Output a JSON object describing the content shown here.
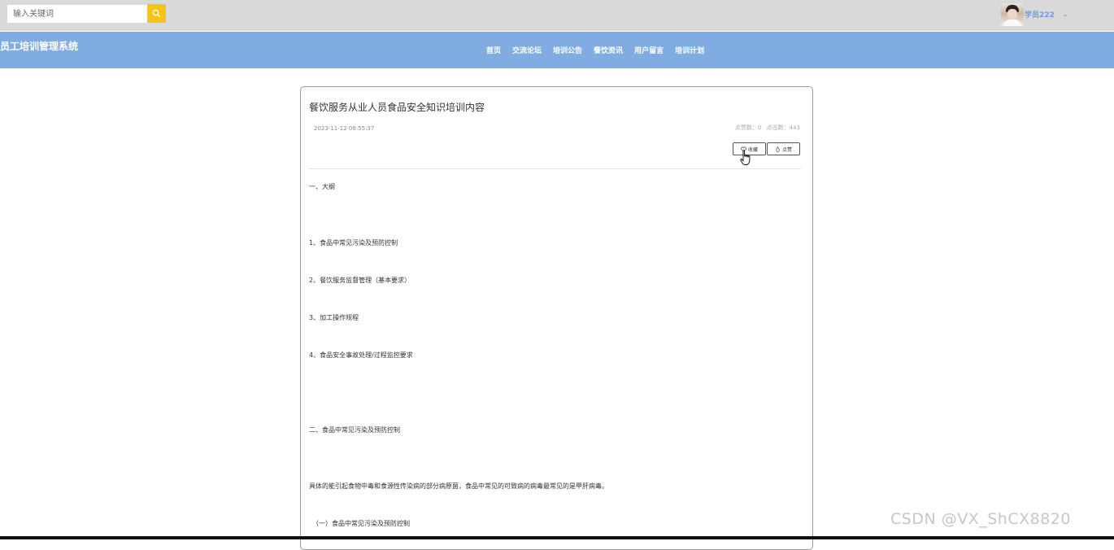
{
  "search": {
    "placeholder": "输入关键词"
  },
  "user": {
    "name": "学员222"
  },
  "brand": {
    "title": "员工培训管理系统"
  },
  "nav": [
    "首页",
    "交流论坛",
    "培训公告",
    "餐饮资讯",
    "用户留言",
    "培训计划"
  ],
  "article": {
    "title": "餐饮服务从业人员食品安全知识培训内容",
    "date": "2023-11-12 08:55:37",
    "likes_label": "点赞数：0",
    "clicks_label": "点击数：443",
    "collect_label": "收藏",
    "like_label": "点赞",
    "lines": [
      "一、大纲",
      "1、食品中常见污染及预防控制",
      "2、餐饮服务监督管理（基本要求）",
      "3、加工操作规程",
      "4、食品安全事故处理/过程监控要求",
      "二、食品中常见污染及预防控制",
      "具体的能引起食物中毒和食源性传染病的部分病原菌，食品中常见的可致病的病毒最常见的是甲肝病毒。",
      "（一）食品中常见污染及预防控制"
    ]
  },
  "watermark": "CSDN @VX_ShCX8820"
}
